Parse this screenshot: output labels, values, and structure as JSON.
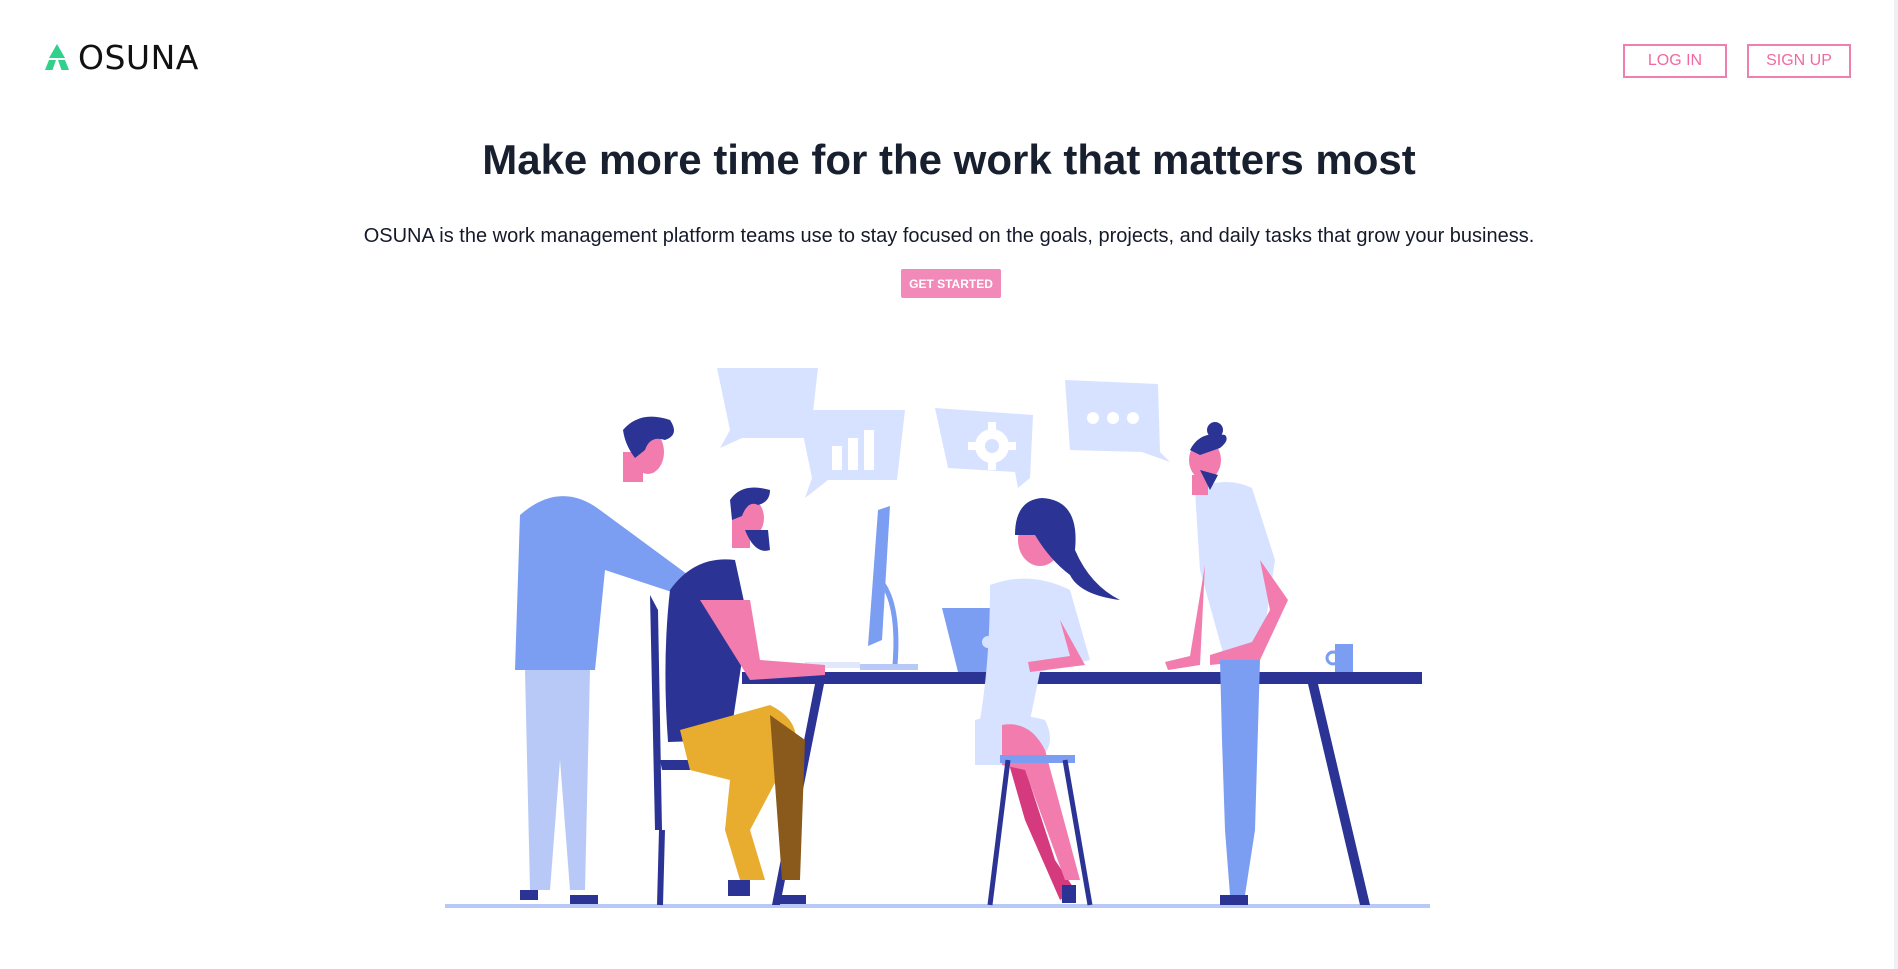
{
  "brand": {
    "name": "OSUNA",
    "logo_icon": "triangle-mark-icon",
    "accent": "#2fd18b"
  },
  "nav": {
    "login_label": "LOG IN",
    "signup_label": "SIGN UP",
    "button_color": "#ef7fae"
  },
  "hero": {
    "headline": "Make more time for the work that matters most",
    "subheadline": "OSUNA is the work management platform teams use to stay focused on the goals, projects, and daily tasks that grow your business.",
    "cta_label": "GET STARTED",
    "cta_color": "#f18ab8"
  },
  "illustration": {
    "description_icons": [
      "chart-bubble-icon",
      "gear-bubble-icon",
      "dots-bubble-icon"
    ],
    "palette": {
      "navy": "#2b3494",
      "blue": "#7b9ef2",
      "light": "#d6e2ff",
      "pink": "#f27cae",
      "magenta": "#d63a7e",
      "yellow": "#e8ac2e"
    }
  }
}
